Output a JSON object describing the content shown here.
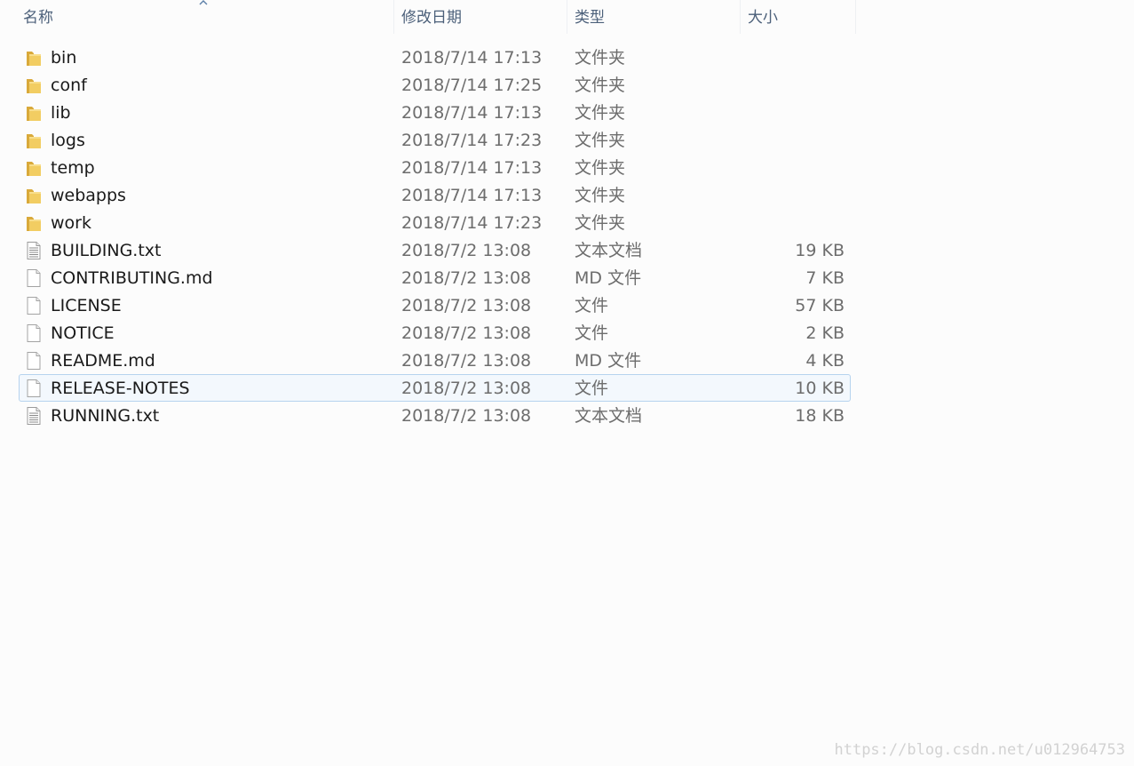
{
  "header": {
    "name_label": "名称",
    "date_label": "修改日期",
    "type_label": "类型",
    "size_label": "大小"
  },
  "files": [
    {
      "name": "bin",
      "date": "2018/7/14 17:13",
      "type": "文件夹",
      "size": "",
      "icon": "folder-icon"
    },
    {
      "name": "conf",
      "date": "2018/7/14 17:25",
      "type": "文件夹",
      "size": "",
      "icon": "folder-icon"
    },
    {
      "name": "lib",
      "date": "2018/7/14 17:13",
      "type": "文件夹",
      "size": "",
      "icon": "folder-icon"
    },
    {
      "name": "logs",
      "date": "2018/7/14 17:23",
      "type": "文件夹",
      "size": "",
      "icon": "folder-icon"
    },
    {
      "name": "temp",
      "date": "2018/7/14 17:13",
      "type": "文件夹",
      "size": "",
      "icon": "folder-icon"
    },
    {
      "name": "webapps",
      "date": "2018/7/14 17:13",
      "type": "文件夹",
      "size": "",
      "icon": "folder-icon"
    },
    {
      "name": "work",
      "date": "2018/7/14 17:23",
      "type": "文件夹",
      "size": "",
      "icon": "folder-icon"
    },
    {
      "name": "BUILDING.txt",
      "date": "2018/7/2 13:08",
      "type": "文本文档",
      "size": "19 KB",
      "icon": "text-document-icon"
    },
    {
      "name": "CONTRIBUTING.md",
      "date": "2018/7/2 13:08",
      "type": "MD 文件",
      "size": "7 KB",
      "icon": "file-icon"
    },
    {
      "name": "LICENSE",
      "date": "2018/7/2 13:08",
      "type": "文件",
      "size": "57 KB",
      "icon": "file-icon"
    },
    {
      "name": "NOTICE",
      "date": "2018/7/2 13:08",
      "type": "文件",
      "size": "2 KB",
      "icon": "file-icon"
    },
    {
      "name": "README.md",
      "date": "2018/7/2 13:08",
      "type": "MD 文件",
      "size": "4 KB",
      "icon": "file-icon"
    },
    {
      "name": "RELEASE-NOTES",
      "date": "2018/7/2 13:08",
      "type": "文件",
      "size": "10 KB",
      "icon": "file-icon",
      "selected": true
    },
    {
      "name": "RUNNING.txt",
      "date": "2018/7/2 13:08",
      "type": "文本文档",
      "size": "18 KB",
      "icon": "text-document-icon"
    }
  ],
  "watermark": "https://blog.csdn.net/u012964753",
  "colors": {
    "header_text": "#4c607a",
    "selection_border": "#b6d3ee",
    "selection_fill": "#f3f8fd",
    "folder": "#e8c25a"
  }
}
